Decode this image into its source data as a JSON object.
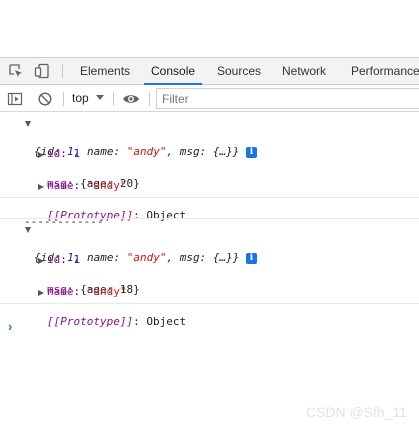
{
  "tabs": [
    {
      "label": "Elements",
      "active": false
    },
    {
      "label": "Console",
      "active": true
    },
    {
      "label": "Sources",
      "active": false
    },
    {
      "label": "Network",
      "active": false
    },
    {
      "label": "Performance",
      "active": false
    }
  ],
  "toolbar": {
    "context_label": "top",
    "filter_placeholder": "Filter"
  },
  "logs": [
    {
      "summary": {
        "open": "{",
        "id_key": "id",
        "id_val": "1",
        "name_key": "name",
        "name_val": "\"andy\"",
        "msg_key": "msg",
        "msg_val": "{…}",
        "close": "}"
      },
      "props": [
        {
          "key": "id",
          "value": "1",
          "expandable": false,
          "value_type": "number"
        },
        {
          "key": "msg",
          "value": "{age: 20}",
          "expandable": true,
          "value_type": "object"
        },
        {
          "key": "name",
          "value": "\"andy\"",
          "expandable": false,
          "value_type": "string"
        },
        {
          "key": "[[Prototype]]",
          "value": "Object",
          "expandable": true,
          "value_type": "proto"
        }
      ]
    },
    {
      "separator": "------------"
    },
    {
      "summary": {
        "open": "{",
        "id_key": "id",
        "id_val": "1",
        "name_key": "name",
        "name_val": "\"andy\"",
        "msg_key": "msg",
        "msg_val": "{…}",
        "close": "}"
      },
      "props": [
        {
          "key": "id",
          "value": "1",
          "expandable": false,
          "value_type": "number"
        },
        {
          "key": "msg",
          "value": "{age: 18}",
          "expandable": true,
          "value_type": "object"
        },
        {
          "key": "name",
          "value": "\"andy\"",
          "expandable": false,
          "value_type": "string"
        },
        {
          "key": "[[Prototype]]",
          "value": "Object",
          "expandable": true,
          "value_type": "proto"
        }
      ]
    }
  ],
  "info_badge": "i",
  "prompt_symbol": "›",
  "watermark": "CSDN @Sfh_11",
  "colors": {
    "accent": "#1a73e8",
    "string": "#c41a16",
    "number": "#1a1aa6",
    "key": "#881391"
  }
}
